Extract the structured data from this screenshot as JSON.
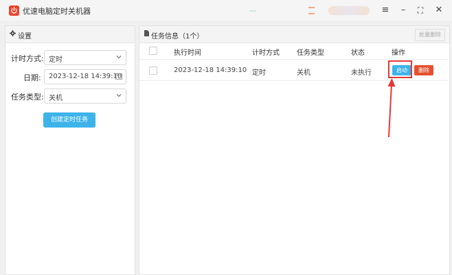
{
  "window": {
    "title": "优速电脑定时关机器",
    "buttons": {
      "menu": "≡",
      "minimize": "–",
      "maximize": "⛶",
      "close": "✕"
    }
  },
  "settings_panel": {
    "title": "设置",
    "mode_label": "计时方式:",
    "mode_value": "定时",
    "date_label": "日期:",
    "date_value": "2023-12-18 14:39:10",
    "type_label": "任务类型:",
    "type_value": "关机",
    "create_button": "创建定时任务"
  },
  "task_panel": {
    "title": "任务信息（1个）",
    "batch_delete": "批量删除",
    "columns": [
      "执行时间",
      "计时方式",
      "任务类型",
      "状态",
      "操作"
    ],
    "rows": [
      {
        "time": "2023-12-18 14:39:10",
        "mode": "定时",
        "type": "关机",
        "status": "未执行",
        "start": "启动",
        "delete": "删除"
      }
    ]
  },
  "colors": {
    "accent": "#3db3ea",
    "danger": "#e4502f",
    "highlight": "#e0383a"
  }
}
